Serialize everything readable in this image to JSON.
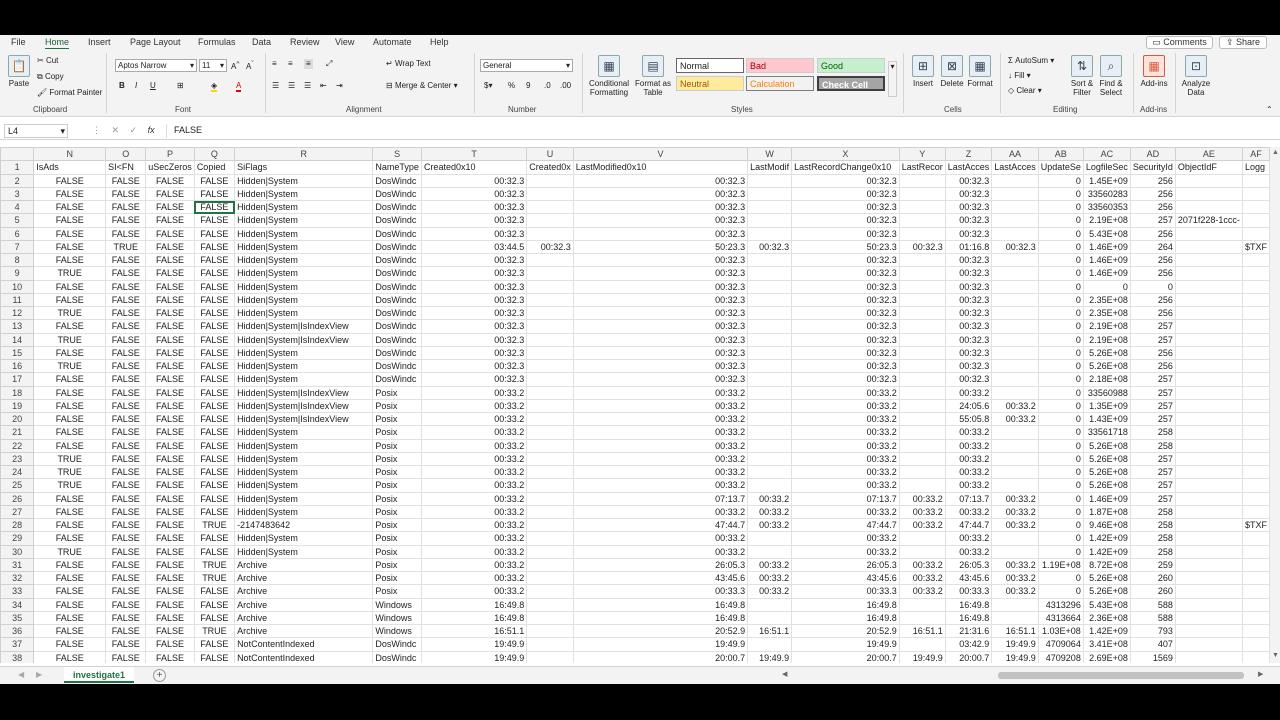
{
  "tabs": [
    "File",
    "Home",
    "Insert",
    "Page Layout",
    "Formulas",
    "Data",
    "Review",
    "View",
    "Automate",
    "Help"
  ],
  "active_tab": "Home",
  "comments_label": "Comments",
  "share_label": "Share",
  "ribbon": {
    "clipboard": {
      "paste": "Paste",
      "cut": "Cut",
      "copy": "Copy",
      "format_painter": "Format Painter",
      "label": "Clipboard"
    },
    "font": {
      "name": "Aptos Narrow",
      "size": "11",
      "label": "Font"
    },
    "alignment": {
      "wrap": "Wrap Text",
      "merge": "Merge & Center",
      "label": "Alignment"
    },
    "number": {
      "format": "General",
      "label": "Number"
    },
    "styles": {
      "conditional": "Conditional Formatting",
      "format_table": "Format as Table",
      "normal": "Normal",
      "bad": "Bad",
      "good": "Good",
      "neutral": "Neutral",
      "calculation": "Calculation",
      "check_cell": "Check Cell",
      "label": "Styles"
    },
    "cells": {
      "insert": "Insert",
      "delete": "Delete",
      "format": "Format",
      "label": "Cells"
    },
    "editing": {
      "autosum": "AutoSum",
      "fill": "Fill",
      "clear": "Clear",
      "sort": "Sort & Filter",
      "find": "Find & Select",
      "label": "Editing"
    },
    "addins": {
      "addins": "Add-ins",
      "label": "Add-ins"
    },
    "analyze": {
      "label": "Analyze Data"
    }
  },
  "formula_bar": {
    "name_box": "L4",
    "fx": "fx",
    "value": "FALSE"
  },
  "columns": [
    "N",
    "O",
    "P",
    "Q",
    "R",
    "S",
    "T",
    "U",
    "V",
    "W",
    "X",
    "Y",
    "Z",
    "AA",
    "AB",
    "AC",
    "AD",
    "AE",
    "AF"
  ],
  "rows": [
    [
      "1",
      "IsAds",
      "SI<FN",
      "uSecZeros",
      "Copied",
      "SiFlags",
      "NameType",
      "Created0x10",
      "Created0x",
      "LastModified0x10",
      "LastModif",
      "LastRecordChange0x10",
      "LastRecor",
      "LastAcces",
      "LastAcces",
      "UpdateSe",
      "LogfileSec",
      "SecurityId",
      "ObjectIdF",
      "Logg"
    ],
    [
      "2",
      "FALSE",
      "FALSE",
      "FALSE",
      "FALSE",
      "Hidden|System",
      "DosWindc",
      "00:32.3",
      "",
      "00:32.3",
      "",
      "00:32.3",
      "",
      "00:32.3",
      "",
      "0",
      "1.45E+09",
      "256",
      "",
      ""
    ],
    [
      "3",
      "FALSE",
      "FALSE",
      "FALSE",
      "FALSE",
      "Hidden|System",
      "DosWindc",
      "00:32.3",
      "",
      "00:32.3",
      "",
      "00:32.3",
      "",
      "00:32.3",
      "",
      "0",
      "33560283",
      "256",
      "",
      ""
    ],
    [
      "4",
      "FALSE",
      "FALSE",
      "FALSE",
      "FALSE",
      "Hidden|System",
      "DosWindc",
      "00:32.3",
      "",
      "00:32.3",
      "",
      "00:32.3",
      "",
      "00:32.3",
      "",
      "0",
      "33560353",
      "256",
      "",
      ""
    ],
    [
      "5",
      "FALSE",
      "FALSE",
      "FALSE",
      "FALSE",
      "Hidden|System",
      "DosWindc",
      "00:32.3",
      "",
      "00:32.3",
      "",
      "00:32.3",
      "",
      "00:32.3",
      "",
      "0",
      "2.19E+08",
      "257",
      "2071f228-1ccc-",
      ""
    ],
    [
      "6",
      "FALSE",
      "FALSE",
      "FALSE",
      "FALSE",
      "Hidden|System",
      "DosWindc",
      "00:32.3",
      "",
      "00:32.3",
      "",
      "00:32.3",
      "",
      "00:32.3",
      "",
      "0",
      "5.43E+08",
      "256",
      "",
      ""
    ],
    [
      "7",
      "FALSE",
      "TRUE",
      "FALSE",
      "FALSE",
      "Hidden|System",
      "DosWindc",
      "03:44.5",
      "00:32.3",
      "50:23.3",
      "00:32.3",
      "50:23.3",
      "00:32.3",
      "01:16.8",
      "00:32.3",
      "0",
      "1.46E+09",
      "264",
      "",
      "$TXF"
    ],
    [
      "8",
      "FALSE",
      "FALSE",
      "FALSE",
      "FALSE",
      "Hidden|System",
      "DosWindc",
      "00:32.3",
      "",
      "00:32.3",
      "",
      "00:32.3",
      "",
      "00:32.3",
      "",
      "0",
      "1.46E+09",
      "256",
      "",
      ""
    ],
    [
      "9",
      "TRUE",
      "FALSE",
      "FALSE",
      "FALSE",
      "Hidden|System",
      "DosWindc",
      "00:32.3",
      "",
      "00:32.3",
      "",
      "00:32.3",
      "",
      "00:32.3",
      "",
      "0",
      "1.46E+09",
      "256",
      "",
      ""
    ],
    [
      "10",
      "FALSE",
      "FALSE",
      "FALSE",
      "FALSE",
      "Hidden|System",
      "DosWindc",
      "00:32.3",
      "",
      "00:32.3",
      "",
      "00:32.3",
      "",
      "00:32.3",
      "",
      "0",
      "0",
      "0",
      "",
      ""
    ],
    [
      "11",
      "FALSE",
      "FALSE",
      "FALSE",
      "FALSE",
      "Hidden|System",
      "DosWindc",
      "00:32.3",
      "",
      "00:32.3",
      "",
      "00:32.3",
      "",
      "00:32.3",
      "",
      "0",
      "2.35E+08",
      "256",
      "",
      ""
    ],
    [
      "12",
      "TRUE",
      "FALSE",
      "FALSE",
      "FALSE",
      "Hidden|System",
      "DosWindc",
      "00:32.3",
      "",
      "00:32.3",
      "",
      "00:32.3",
      "",
      "00:32.3",
      "",
      "0",
      "2.35E+08",
      "256",
      "",
      ""
    ],
    [
      "13",
      "FALSE",
      "FALSE",
      "FALSE",
      "FALSE",
      "Hidden|System|IsIndexView",
      "DosWindc",
      "00:32.3",
      "",
      "00:32.3",
      "",
      "00:32.3",
      "",
      "00:32.3",
      "",
      "0",
      "2.19E+08",
      "257",
      "",
      ""
    ],
    [
      "14",
      "TRUE",
      "FALSE",
      "FALSE",
      "FALSE",
      "Hidden|System|IsIndexView",
      "DosWindc",
      "00:32.3",
      "",
      "00:32.3",
      "",
      "00:32.3",
      "",
      "00:32.3",
      "",
      "0",
      "2.19E+08",
      "257",
      "",
      ""
    ],
    [
      "15",
      "FALSE",
      "FALSE",
      "FALSE",
      "FALSE",
      "Hidden|System",
      "DosWindc",
      "00:32.3",
      "",
      "00:32.3",
      "",
      "00:32.3",
      "",
      "00:32.3",
      "",
      "0",
      "5.26E+08",
      "256",
      "",
      ""
    ],
    [
      "16",
      "TRUE",
      "FALSE",
      "FALSE",
      "FALSE",
      "Hidden|System",
      "DosWindc",
      "00:32.3",
      "",
      "00:32.3",
      "",
      "00:32.3",
      "",
      "00:32.3",
      "",
      "0",
      "5.26E+08",
      "256",
      "",
      ""
    ],
    [
      "17",
      "FALSE",
      "FALSE",
      "FALSE",
      "FALSE",
      "Hidden|System",
      "DosWindc",
      "00:32.3",
      "",
      "00:32.3",
      "",
      "00:32.3",
      "",
      "00:32.3",
      "",
      "0",
      "2.18E+08",
      "257",
      "",
      ""
    ],
    [
      "18",
      "FALSE",
      "FALSE",
      "FALSE",
      "FALSE",
      "Hidden|System|IsIndexView",
      "Posix",
      "00:33.2",
      "",
      "00:33.2",
      "",
      "00:33.2",
      "",
      "00:33.2",
      "",
      "0",
      "33560988",
      "257",
      "",
      ""
    ],
    [
      "19",
      "FALSE",
      "FALSE",
      "FALSE",
      "FALSE",
      "Hidden|System|IsIndexView",
      "Posix",
      "00:33.2",
      "",
      "00:33.2",
      "",
      "00:33.2",
      "",
      "24:05.6",
      "00:33.2",
      "0",
      "1.35E+09",
      "257",
      "",
      ""
    ],
    [
      "20",
      "FALSE",
      "FALSE",
      "FALSE",
      "FALSE",
      "Hidden|System|IsIndexView",
      "Posix",
      "00:33.2",
      "",
      "00:33.2",
      "",
      "00:33.2",
      "",
      "55:05.8",
      "00:33.2",
      "0",
      "1.43E+09",
      "257",
      "",
      ""
    ],
    [
      "21",
      "FALSE",
      "FALSE",
      "FALSE",
      "FALSE",
      "Hidden|System",
      "Posix",
      "00:33.2",
      "",
      "00:33.2",
      "",
      "00:33.2",
      "",
      "00:33.2",
      "",
      "0",
      "33561718",
      "258",
      "",
      ""
    ],
    [
      "22",
      "FALSE",
      "FALSE",
      "FALSE",
      "FALSE",
      "Hidden|System",
      "Posix",
      "00:33.2",
      "",
      "00:33.2",
      "",
      "00:33.2",
      "",
      "00:33.2",
      "",
      "0",
      "5.26E+08",
      "258",
      "",
      ""
    ],
    [
      "23",
      "TRUE",
      "FALSE",
      "FALSE",
      "FALSE",
      "Hidden|System",
      "Posix",
      "00:33.2",
      "",
      "00:33.2",
      "",
      "00:33.2",
      "",
      "00:33.2",
      "",
      "0",
      "5.26E+08",
      "257",
      "",
      ""
    ],
    [
      "24",
      "TRUE",
      "FALSE",
      "FALSE",
      "FALSE",
      "Hidden|System",
      "Posix",
      "00:33.2",
      "",
      "00:33.2",
      "",
      "00:33.2",
      "",
      "00:33.2",
      "",
      "0",
      "5.26E+08",
      "257",
      "",
      ""
    ],
    [
      "25",
      "TRUE",
      "FALSE",
      "FALSE",
      "FALSE",
      "Hidden|System",
      "Posix",
      "00:33.2",
      "",
      "00:33.2",
      "",
      "00:33.2",
      "",
      "00:33.2",
      "",
      "0",
      "5.26E+08",
      "257",
      "",
      ""
    ],
    [
      "26",
      "FALSE",
      "FALSE",
      "FALSE",
      "FALSE",
      "Hidden|System",
      "Posix",
      "00:33.2",
      "",
      "07:13.7",
      "00:33.2",
      "07:13.7",
      "00:33.2",
      "07:13.7",
      "00:33.2",
      "0",
      "1.46E+09",
      "257",
      "",
      ""
    ],
    [
      "27",
      "FALSE",
      "FALSE",
      "FALSE",
      "FALSE",
      "Hidden|System",
      "Posix",
      "00:33.2",
      "",
      "00:33.2",
      "00:33.2",
      "00:33.2",
      "00:33.2",
      "00:33.2",
      "00:33.2",
      "0",
      "1.87E+08",
      "258",
      "",
      ""
    ],
    [
      "28",
      "FALSE",
      "FALSE",
      "FALSE",
      "TRUE",
      "-2147483642",
      "Posix",
      "00:33.2",
      "",
      "47:44.7",
      "00:33.2",
      "47:44.7",
      "00:33.2",
      "47:44.7",
      "00:33.2",
      "0",
      "9.46E+08",
      "258",
      "",
      "$TXF"
    ],
    [
      "29",
      "FALSE",
      "FALSE",
      "FALSE",
      "FALSE",
      "Hidden|System",
      "Posix",
      "00:33.2",
      "",
      "00:33.2",
      "",
      "00:33.2",
      "",
      "00:33.2",
      "",
      "0",
      "1.42E+09",
      "258",
      "",
      ""
    ],
    [
      "30",
      "TRUE",
      "FALSE",
      "FALSE",
      "FALSE",
      "Hidden|System",
      "Posix",
      "00:33.2",
      "",
      "00:33.2",
      "",
      "00:33.2",
      "",
      "00:33.2",
      "",
      "0",
      "1.42E+09",
      "258",
      "",
      ""
    ],
    [
      "31",
      "FALSE",
      "FALSE",
      "FALSE",
      "TRUE",
      "Archive",
      "Posix",
      "00:33.2",
      "",
      "26:05.3",
      "00:33.2",
      "26:05.3",
      "00:33.2",
      "26:05.3",
      "00:33.2",
      "1.19E+08",
      "8.72E+08",
      "259",
      "",
      ""
    ],
    [
      "32",
      "FALSE",
      "FALSE",
      "FALSE",
      "TRUE",
      "Archive",
      "Posix",
      "00:33.2",
      "",
      "43:45.6",
      "00:33.2",
      "43:45.6",
      "00:33.2",
      "43:45.6",
      "00:33.2",
      "0",
      "5.26E+08",
      "260",
      "",
      ""
    ],
    [
      "33",
      "FALSE",
      "FALSE",
      "FALSE",
      "FALSE",
      "Archive",
      "Posix",
      "00:33.2",
      "",
      "00:33.3",
      "00:33.2",
      "00:33.3",
      "00:33.2",
      "00:33.3",
      "00:33.2",
      "0",
      "5.26E+08",
      "260",
      "",
      ""
    ],
    [
      "34",
      "FALSE",
      "FALSE",
      "FALSE",
      "FALSE",
      "Archive",
      "Windows",
      "16:49.8",
      "",
      "16:49.8",
      "",
      "16:49.8",
      "",
      "16:49.8",
      "",
      "4313296",
      "5.43E+08",
      "588",
      "",
      ""
    ],
    [
      "35",
      "FALSE",
      "FALSE",
      "FALSE",
      "FALSE",
      "Archive",
      "Windows",
      "16:49.8",
      "",
      "16:49.8",
      "",
      "16:49.8",
      "",
      "16:49.8",
      "",
      "4313664",
      "2.36E+08",
      "588",
      "",
      ""
    ],
    [
      "36",
      "FALSE",
      "FALSE",
      "FALSE",
      "TRUE",
      "Archive",
      "Windows",
      "16:51.1",
      "",
      "20:52.9",
      "16:51.1",
      "20:52.9",
      "16:51.1",
      "21:31.6",
      "16:51.1",
      "1.03E+08",
      "1.42E+09",
      "793",
      "",
      ""
    ],
    [
      "37",
      "FALSE",
      "FALSE",
      "FALSE",
      "FALSE",
      "NotContentIndexed",
      "DosWindc",
      "19:49.9",
      "",
      "19:49.9",
      "",
      "19:49.9",
      "",
      "03:42.9",
      "19:49.9",
      "4709064",
      "3.41E+08",
      "407",
      "",
      ""
    ],
    [
      "38",
      "FALSE",
      "FALSE",
      "FALSE",
      "FALSE",
      "NotContentIndexed",
      "DosWindc",
      "19:49.9",
      "",
      "20:00.7",
      "19:49.9",
      "20:00.7",
      "19:49.9",
      "20:00.7",
      "19:49.9",
      "4709208",
      "2.69E+08",
      "1569",
      "",
      ""
    ]
  ],
  "sheet_tab": "investigate1",
  "add_sheet": "+",
  "accent_color": "#217346"
}
